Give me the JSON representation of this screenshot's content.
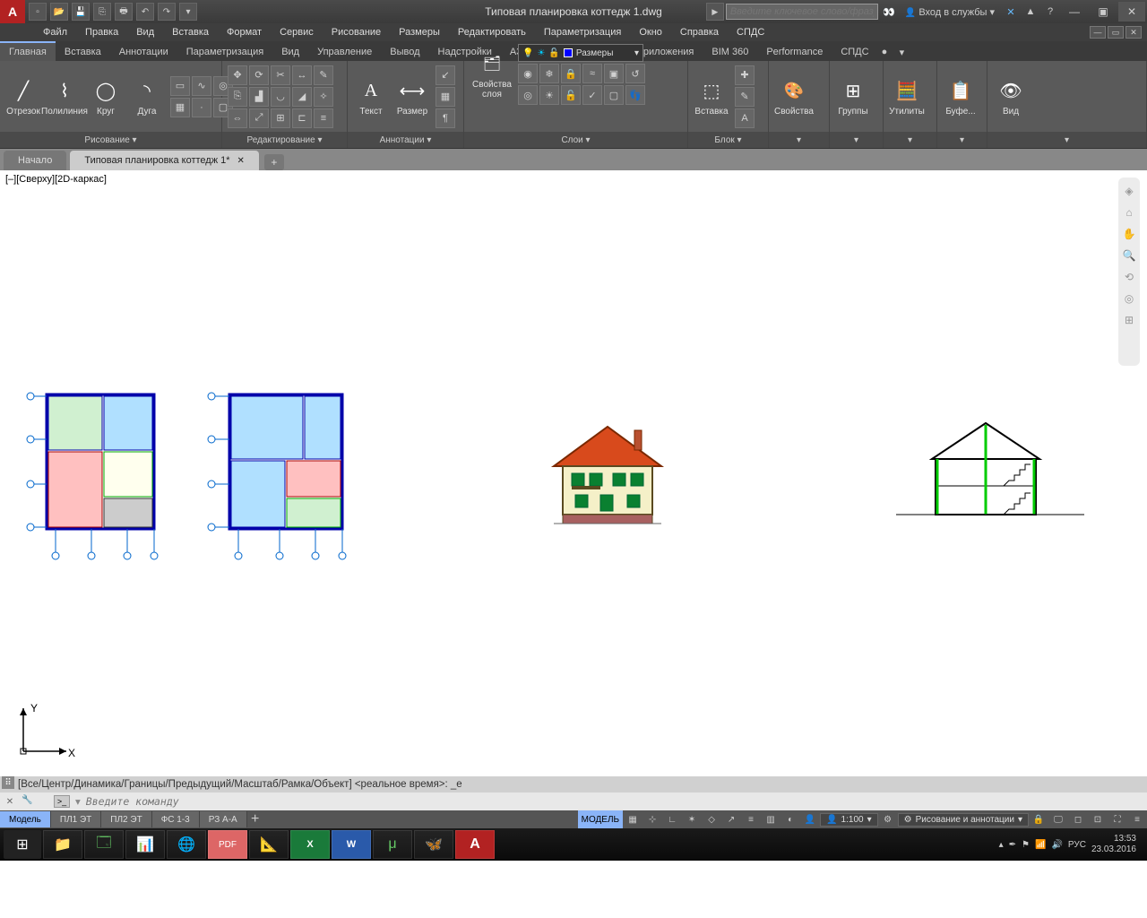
{
  "title": "Типовая планировка коттедж 1.dwg",
  "search_placeholder": "Введите ключевое слово/фразу",
  "signin_label": "Вход в службы",
  "menubar": [
    "Файл",
    "Правка",
    "Вид",
    "Вставка",
    "Формат",
    "Сервис",
    "Рисование",
    "Размеры",
    "Редактировать",
    "Параметризация",
    "Окно",
    "Справка",
    "СПДС"
  ],
  "ribbon_tabs": [
    "Главная",
    "Вставка",
    "Аннотации",
    "Параметризация",
    "Вид",
    "Управление",
    "Вывод",
    "Надстройки",
    "A360",
    "Рекомендованные приложения",
    "BIM 360",
    "Performance",
    "СПДС"
  ],
  "ribbon_active": 0,
  "panels": {
    "draw": {
      "title": "Рисование ▾",
      "line": "Отрезок",
      "polyline": "Полилиния",
      "circle": "Круг",
      "arc": "Дуга"
    },
    "modify": {
      "title": "Редактирование ▾"
    },
    "annot": {
      "title": "Аннотации ▾",
      "text": "Текст",
      "dim": "Размер"
    },
    "layers": {
      "title": "Слои ▾",
      "props": "Свойства\nслоя",
      "combo": "Размеры"
    },
    "block": {
      "title": "Блок ▾",
      "insert": "Вставка"
    },
    "props": {
      "title": "▾",
      "btn": "Свойства"
    },
    "groups": {
      "title": "▾",
      "btn": "Группы"
    },
    "utils": {
      "title": "▾",
      "btn": "Утилиты"
    },
    "clip": {
      "title": "▾",
      "btn": "Буфе..."
    },
    "view": {
      "title": "▾",
      "btn": "Вид"
    }
  },
  "doctabs": [
    {
      "label": "Начало",
      "active": false
    },
    {
      "label": "Типовая планировка коттедж 1*",
      "active": true
    }
  ],
  "viewport_label": "[–][Сверху][2D-каркас]",
  "ucs": {
    "x": "X",
    "y": "Y"
  },
  "cmd_history": "[Все/Центр/Динамика/Границы/Предыдущий/Масштаб/Рамка/Объект] <реальное время>: _e",
  "cmd_placeholder": "Введите команду",
  "layout_tabs": [
    "Модель",
    "ПЛ1 ЭТ",
    "ПЛ2 ЭТ",
    "ФС 1-3",
    "РЗ А-А"
  ],
  "layout_active": 0,
  "statusbar": {
    "model": "МОДЕЛЬ",
    "scale": "1:100",
    "workspace": "Рисование и аннотации"
  },
  "tray": {
    "lang": "РУС",
    "time": "13:53",
    "date": "23.03.2016"
  }
}
